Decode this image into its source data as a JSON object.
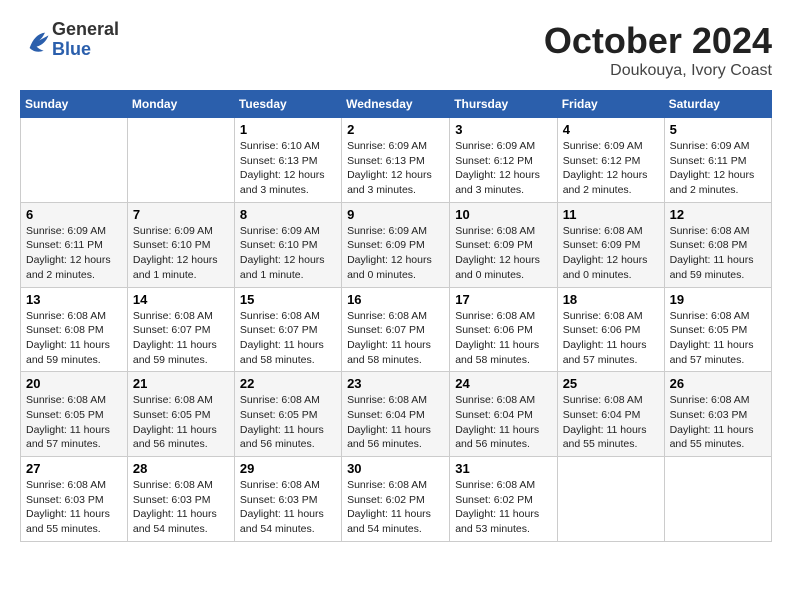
{
  "header": {
    "logo_general": "General",
    "logo_blue": "Blue",
    "title": "October 2024",
    "subtitle": "Doukouya, Ivory Coast"
  },
  "columns": [
    "Sunday",
    "Monday",
    "Tuesday",
    "Wednesday",
    "Thursday",
    "Friday",
    "Saturday"
  ],
  "weeks": [
    [
      {
        "day": "",
        "info": ""
      },
      {
        "day": "",
        "info": ""
      },
      {
        "day": "1",
        "info": "Sunrise: 6:10 AM\nSunset: 6:13 PM\nDaylight: 12 hours and 3 minutes."
      },
      {
        "day": "2",
        "info": "Sunrise: 6:09 AM\nSunset: 6:13 PM\nDaylight: 12 hours and 3 minutes."
      },
      {
        "day": "3",
        "info": "Sunrise: 6:09 AM\nSunset: 6:12 PM\nDaylight: 12 hours and 3 minutes."
      },
      {
        "day": "4",
        "info": "Sunrise: 6:09 AM\nSunset: 6:12 PM\nDaylight: 12 hours and 2 minutes."
      },
      {
        "day": "5",
        "info": "Sunrise: 6:09 AM\nSunset: 6:11 PM\nDaylight: 12 hours and 2 minutes."
      }
    ],
    [
      {
        "day": "6",
        "info": "Sunrise: 6:09 AM\nSunset: 6:11 PM\nDaylight: 12 hours and 2 minutes."
      },
      {
        "day": "7",
        "info": "Sunrise: 6:09 AM\nSunset: 6:10 PM\nDaylight: 12 hours and 1 minute."
      },
      {
        "day": "8",
        "info": "Sunrise: 6:09 AM\nSunset: 6:10 PM\nDaylight: 12 hours and 1 minute."
      },
      {
        "day": "9",
        "info": "Sunrise: 6:09 AM\nSunset: 6:09 PM\nDaylight: 12 hours and 0 minutes."
      },
      {
        "day": "10",
        "info": "Sunrise: 6:08 AM\nSunset: 6:09 PM\nDaylight: 12 hours and 0 minutes."
      },
      {
        "day": "11",
        "info": "Sunrise: 6:08 AM\nSunset: 6:09 PM\nDaylight: 12 hours and 0 minutes."
      },
      {
        "day": "12",
        "info": "Sunrise: 6:08 AM\nSunset: 6:08 PM\nDaylight: 11 hours and 59 minutes."
      }
    ],
    [
      {
        "day": "13",
        "info": "Sunrise: 6:08 AM\nSunset: 6:08 PM\nDaylight: 11 hours and 59 minutes."
      },
      {
        "day": "14",
        "info": "Sunrise: 6:08 AM\nSunset: 6:07 PM\nDaylight: 11 hours and 59 minutes."
      },
      {
        "day": "15",
        "info": "Sunrise: 6:08 AM\nSunset: 6:07 PM\nDaylight: 11 hours and 58 minutes."
      },
      {
        "day": "16",
        "info": "Sunrise: 6:08 AM\nSunset: 6:07 PM\nDaylight: 11 hours and 58 minutes."
      },
      {
        "day": "17",
        "info": "Sunrise: 6:08 AM\nSunset: 6:06 PM\nDaylight: 11 hours and 58 minutes."
      },
      {
        "day": "18",
        "info": "Sunrise: 6:08 AM\nSunset: 6:06 PM\nDaylight: 11 hours and 57 minutes."
      },
      {
        "day": "19",
        "info": "Sunrise: 6:08 AM\nSunset: 6:05 PM\nDaylight: 11 hours and 57 minutes."
      }
    ],
    [
      {
        "day": "20",
        "info": "Sunrise: 6:08 AM\nSunset: 6:05 PM\nDaylight: 11 hours and 57 minutes."
      },
      {
        "day": "21",
        "info": "Sunrise: 6:08 AM\nSunset: 6:05 PM\nDaylight: 11 hours and 56 minutes."
      },
      {
        "day": "22",
        "info": "Sunrise: 6:08 AM\nSunset: 6:05 PM\nDaylight: 11 hours and 56 minutes."
      },
      {
        "day": "23",
        "info": "Sunrise: 6:08 AM\nSunset: 6:04 PM\nDaylight: 11 hours and 56 minutes."
      },
      {
        "day": "24",
        "info": "Sunrise: 6:08 AM\nSunset: 6:04 PM\nDaylight: 11 hours and 56 minutes."
      },
      {
        "day": "25",
        "info": "Sunrise: 6:08 AM\nSunset: 6:04 PM\nDaylight: 11 hours and 55 minutes."
      },
      {
        "day": "26",
        "info": "Sunrise: 6:08 AM\nSunset: 6:03 PM\nDaylight: 11 hours and 55 minutes."
      }
    ],
    [
      {
        "day": "27",
        "info": "Sunrise: 6:08 AM\nSunset: 6:03 PM\nDaylight: 11 hours and 55 minutes."
      },
      {
        "day": "28",
        "info": "Sunrise: 6:08 AM\nSunset: 6:03 PM\nDaylight: 11 hours and 54 minutes."
      },
      {
        "day": "29",
        "info": "Sunrise: 6:08 AM\nSunset: 6:03 PM\nDaylight: 11 hours and 54 minutes."
      },
      {
        "day": "30",
        "info": "Sunrise: 6:08 AM\nSunset: 6:02 PM\nDaylight: 11 hours and 54 minutes."
      },
      {
        "day": "31",
        "info": "Sunrise: 6:08 AM\nSunset: 6:02 PM\nDaylight: 11 hours and 53 minutes."
      },
      {
        "day": "",
        "info": ""
      },
      {
        "day": "",
        "info": ""
      }
    ]
  ]
}
